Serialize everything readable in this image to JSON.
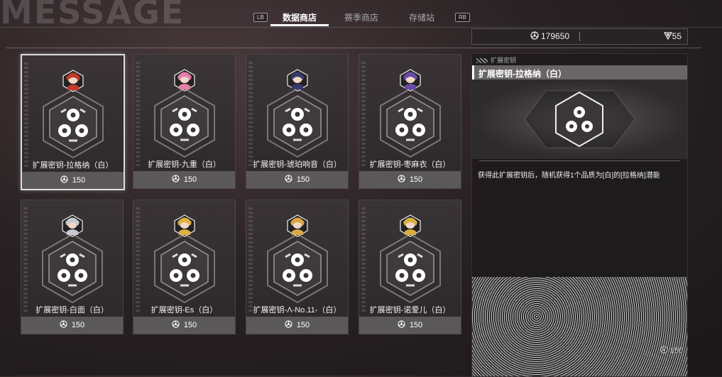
{
  "header": {
    "bg_title": "MESSAGE",
    "left_hint": "LB",
    "right_hint": "RB",
    "tabs": [
      {
        "label": "数据商店",
        "active": true
      },
      {
        "label": "赛季商店",
        "active": false
      },
      {
        "label": "存储站",
        "active": false
      }
    ]
  },
  "currency": {
    "primary_value": "179650",
    "primary_icon": "data-chip-icon",
    "secondary_value": "55",
    "secondary_icon": "gem-icon"
  },
  "items": [
    {
      "name": "扩展密钥-拉格纳（白）",
      "price": "150",
      "color": "#c0392b",
      "selected": true
    },
    {
      "name": "扩展密钥-九重（白）",
      "price": "150",
      "color": "#e87fa8",
      "selected": false
    },
    {
      "name": "扩展密钥-琥珀响音（白）",
      "price": "150",
      "color": "#3a3a6a",
      "selected": false
    },
    {
      "name": "扩展密钥-枣麻衣（白）",
      "price": "150",
      "color": "#6a4aa8",
      "selected": false
    },
    {
      "name": "扩展密钥-白面（白）",
      "price": "150",
      "color": "#c8c8d0",
      "selected": false
    },
    {
      "name": "扩展密钥-Es（白）",
      "price": "150",
      "color": "#e0b040",
      "selected": false
    },
    {
      "name": "扩展密钥-Λ-No.11-（白）",
      "price": "150",
      "color": "#d8a848",
      "selected": false
    },
    {
      "name": "扩展密钥-诺爱儿（白）",
      "price": "150",
      "color": "#d8b040",
      "selected": false
    }
  ],
  "detail": {
    "category": "扩展密钥",
    "title": "扩展密钥-拉格纳（白）",
    "description": "获得此扩展密钥后，随机获得1个品质为[白]的[拉格纳]潜能",
    "price": "150"
  }
}
